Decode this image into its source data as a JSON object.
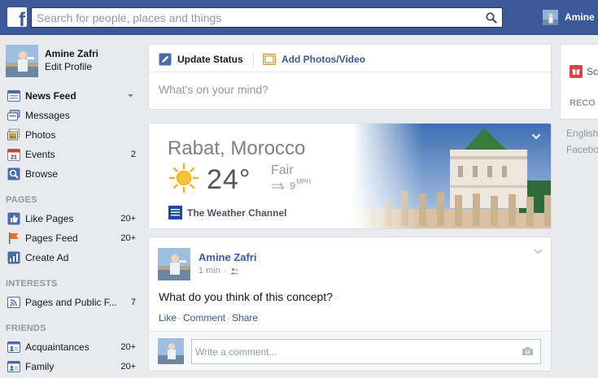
{
  "header": {
    "logo_letter": "f",
    "search_placeholder": "Search for people, places and things",
    "user_name": "Amine"
  },
  "profile": {
    "name": "Amine Zafri",
    "edit_label": "Edit Profile"
  },
  "nav": {
    "favorites": [
      {
        "label": "News Feed",
        "icon": "news-feed-icon"
      },
      {
        "label": "Messages",
        "icon": "messages-icon"
      },
      {
        "label": "Photos",
        "icon": "photos-icon"
      },
      {
        "label": "Events",
        "icon": "events-icon",
        "count": "2",
        "calendar_number": "21"
      },
      {
        "label": "Browse",
        "icon": "browse-icon"
      }
    ],
    "pages_heading": "PAGES",
    "pages": [
      {
        "label": "Like Pages",
        "icon": "like-pages-icon",
        "count": "20+"
      },
      {
        "label": "Pages Feed",
        "icon": "pages-feed-icon",
        "count": "20+"
      },
      {
        "label": "Create Ad",
        "icon": "create-ad-icon"
      }
    ],
    "interests_heading": "INTERESTS",
    "interests": [
      {
        "label": "Pages and Public F...",
        "icon": "pages-public-feed-icon",
        "count": "7"
      }
    ],
    "friends_heading": "FRIENDS",
    "friends": [
      {
        "label": "Acquaintances",
        "icon": "acquaintances-icon",
        "count": "20+"
      },
      {
        "label": "Family",
        "icon": "family-icon",
        "count": "20+"
      }
    ]
  },
  "composer": {
    "status_label": "Update Status",
    "photo_label": "Add Photos/Video",
    "placeholder": "What's on your mind?"
  },
  "weather": {
    "city": "Rabat, Morocco",
    "temperature": "24°",
    "condition": "Fair",
    "wind_speed": "9",
    "wind_unit": "MPH",
    "channel": "The Weather Channel"
  },
  "post": {
    "author": "Amine Zafri",
    "time": "1 min",
    "text": "What do you think of this concept?",
    "actions": [
      "Like",
      "Comment",
      "Share"
    ],
    "comment_placeholder": "Write a comment..."
  },
  "right": {
    "item_label": "Sc",
    "section_heading": "RECO",
    "language": "English",
    "footer": "Facebo"
  },
  "colors": {
    "brand": "#3b5998",
    "background": "#e9eaed",
    "muted": "#9197a3"
  }
}
